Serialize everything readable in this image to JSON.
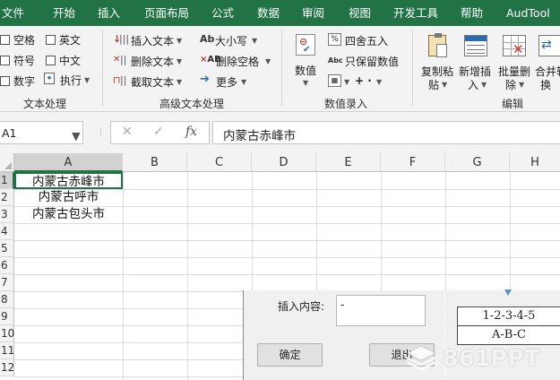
{
  "menubar": {
    "tabs": [
      "文件",
      "开始",
      "插入",
      "页面布局",
      "公式",
      "数据",
      "审阅",
      "视图",
      "开发工具",
      "帮助",
      "AudTool"
    ]
  },
  "ribbon": {
    "text_processing": {
      "label": "文本处理",
      "checkboxes": [
        "空格",
        "英文",
        "符号",
        "中文",
        "数字"
      ],
      "execute": "执行"
    },
    "advanced_text": {
      "label": "高级文本处理",
      "insert_text": "插入文本",
      "delete_text": "删除文本",
      "extract_text": "截取文本",
      "case": "大小写",
      "delete_space": "删除空格",
      "more": "更多"
    },
    "number_entry": {
      "label": "数值录入",
      "number": "数值",
      "round": "四舍五入",
      "keep_number": "只保留数值",
      "ops": "+ ·"
    },
    "edit": {
      "label": "编辑",
      "copy_paste": [
        "复制粘",
        "贴"
      ],
      "new_insert": [
        "新增插",
        "入"
      ],
      "batch_delete": [
        "批量删",
        "除"
      ],
      "merge": [
        "合并转",
        "换"
      ]
    }
  },
  "formula_bar": {
    "name_box": "A1",
    "cancel": "✕",
    "enter": "✓",
    "fx": "fx",
    "content": "内蒙古赤峰市"
  },
  "sheet": {
    "columns": [
      "A",
      "B",
      "C",
      "D",
      "E",
      "F",
      "G",
      "H"
    ],
    "rows": [
      "1",
      "2",
      "3",
      "4",
      "5",
      "6",
      "7",
      "8",
      "9",
      "10",
      "11",
      "12"
    ],
    "cells": [
      "内蒙古赤峰市",
      "内蒙古呼市",
      "内蒙古包头市"
    ]
  },
  "dialog": {
    "insert_label": "插入内容:",
    "insert_value": "-",
    "ok": "确定",
    "exit": "退出"
  },
  "preview": [
    "1-2-3-4-5",
    "A-B-C"
  ],
  "watermark": "861PPT"
}
